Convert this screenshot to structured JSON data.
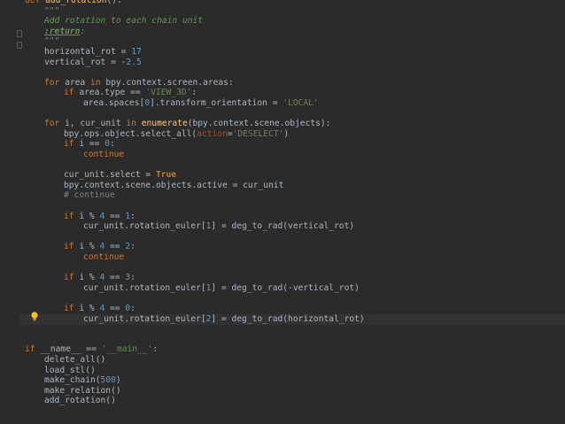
{
  "editor": {
    "lines": [
      {
        "indent": 0,
        "tokens": [
          [
            "kw",
            "def "
          ],
          [
            "fn",
            "add_rotation"
          ],
          [
            "",
            "():"
          ]
        ]
      },
      {
        "indent": 1,
        "tokens": [
          [
            "doc",
            "\"\"\""
          ]
        ]
      },
      {
        "indent": 1,
        "tokens": [
          [
            "doc",
            "Add rotation to each chain unit"
          ]
        ]
      },
      {
        "indent": 1,
        "tokens": [
          [
            "doctag",
            ":return"
          ],
          [
            "doc",
            ":"
          ]
        ]
      },
      {
        "indent": 1,
        "tokens": [
          [
            "doc",
            "\"\"\""
          ]
        ]
      },
      {
        "indent": 1,
        "tokens": [
          [
            "",
            "horizontal_rot = "
          ],
          [
            "num",
            "17"
          ]
        ]
      },
      {
        "indent": 1,
        "tokens": [
          [
            "",
            "vertical_rot = -"
          ],
          [
            "num",
            "2.5"
          ]
        ]
      },
      {
        "indent": 0,
        "tokens": []
      },
      {
        "indent": 1,
        "tokens": [
          [
            "kw",
            "for "
          ],
          [
            "",
            "area "
          ],
          [
            "kw",
            "in "
          ],
          [
            "",
            "bpy.context.screen.areas:"
          ]
        ]
      },
      {
        "indent": 2,
        "tokens": [
          [
            "kw",
            "if "
          ],
          [
            "",
            "area.type == "
          ],
          [
            "str",
            "'VIEW_3D'"
          ],
          [
            "",
            ":"
          ]
        ]
      },
      {
        "indent": 3,
        "tokens": [
          [
            "",
            "area.spaces["
          ],
          [
            "num",
            "0"
          ],
          [
            "",
            "].transform_orientation = "
          ],
          [
            "str",
            "'LOCAL'"
          ]
        ]
      },
      {
        "indent": 0,
        "tokens": []
      },
      {
        "indent": 1,
        "tokens": [
          [
            "kw",
            "for "
          ],
          [
            "",
            "i, cur_unit "
          ],
          [
            "kw",
            "in "
          ],
          [
            "fn",
            "enumerate"
          ],
          [
            "",
            "(bpy.context.scene.objects):"
          ]
        ]
      },
      {
        "indent": 2,
        "tokens": [
          [
            "",
            "bpy.ops.object.select_all("
          ],
          [
            "param",
            "action"
          ],
          [
            "",
            "="
          ],
          [
            "str",
            "'DESELECT'"
          ],
          [
            "",
            ")"
          ]
        ]
      },
      {
        "indent": 2,
        "tokens": [
          [
            "kw",
            "if "
          ],
          [
            "",
            "i == "
          ],
          [
            "num",
            "0"
          ],
          [
            "",
            ":"
          ]
        ]
      },
      {
        "indent": 3,
        "tokens": [
          [
            "kw",
            "continue"
          ]
        ]
      },
      {
        "indent": 0,
        "tokens": []
      },
      {
        "indent": 2,
        "tokens": [
          [
            "",
            "cur_unit.select = "
          ],
          [
            "bool",
            "True"
          ]
        ]
      },
      {
        "indent": 2,
        "tokens": [
          [
            "",
            "bpy.context.scene.objects.active = cur_unit"
          ]
        ]
      },
      {
        "indent": 2,
        "tokens": [
          [
            "cmt",
            "# continue"
          ]
        ]
      },
      {
        "indent": 0,
        "tokens": []
      },
      {
        "indent": 2,
        "tokens": [
          [
            "kw",
            "if "
          ],
          [
            "",
            "i % "
          ],
          [
            "num",
            "4"
          ],
          [
            "",
            " == "
          ],
          [
            "num",
            "1"
          ],
          [
            "",
            ":"
          ]
        ]
      },
      {
        "indent": 3,
        "tokens": [
          [
            "",
            "cur_unit.rotation_euler["
          ],
          [
            "num",
            "1"
          ],
          [
            "",
            "] = deg_to_rad(vertical_rot)"
          ]
        ]
      },
      {
        "indent": 0,
        "tokens": []
      },
      {
        "indent": 2,
        "tokens": [
          [
            "kw",
            "if "
          ],
          [
            "",
            "i % "
          ],
          [
            "num",
            "4"
          ],
          [
            "",
            " == "
          ],
          [
            "num",
            "2"
          ],
          [
            "",
            ":"
          ]
        ]
      },
      {
        "indent": 3,
        "tokens": [
          [
            "kw",
            "continue"
          ]
        ]
      },
      {
        "indent": 0,
        "tokens": []
      },
      {
        "indent": 2,
        "tokens": [
          [
            "kw",
            "if "
          ],
          [
            "",
            "i % "
          ],
          [
            "num",
            "4"
          ],
          [
            "",
            " == "
          ],
          [
            "num",
            "3"
          ],
          [
            "",
            ":"
          ]
        ]
      },
      {
        "indent": 3,
        "tokens": [
          [
            "",
            "cur_unit.rotation_euler["
          ],
          [
            "num",
            "1"
          ],
          [
            "",
            "] = deg_to_rad(-vertical_rot)"
          ]
        ]
      },
      {
        "indent": 0,
        "tokens": []
      },
      {
        "indent": 2,
        "tokens": [
          [
            "kw",
            "if "
          ],
          [
            "",
            "i % "
          ],
          [
            "num",
            "4"
          ],
          [
            "",
            " == "
          ],
          [
            "num",
            "0"
          ],
          [
            "",
            ":"
          ]
        ]
      },
      {
        "indent": 3,
        "tokens": [
          [
            "",
            "cur_unit.rotation_euler["
          ],
          [
            "num",
            "2"
          ],
          [
            "",
            "] = deg_to_rad(horizontal_rot)"
          ]
        ]
      },
      {
        "indent": 0,
        "tokens": []
      },
      {
        "indent": 0,
        "tokens": []
      },
      {
        "indent": 0,
        "tokens": [
          [
            "kw",
            "if "
          ],
          [
            "",
            "__name__ == "
          ],
          [
            "str",
            "'__main__'"
          ],
          [
            "",
            ":"
          ]
        ]
      },
      {
        "indent": 1,
        "tokens": [
          [
            "",
            "delete_all()"
          ]
        ]
      },
      {
        "indent": 1,
        "tokens": [
          [
            "",
            "load_stl()"
          ]
        ]
      },
      {
        "indent": 1,
        "tokens": [
          [
            "",
            "make_chain("
          ],
          [
            "num",
            "500"
          ],
          [
            "",
            ")"
          ]
        ]
      },
      {
        "indent": 1,
        "tokens": [
          [
            "",
            "make_relation()"
          ]
        ]
      },
      {
        "indent": 1,
        "tokens": [
          [
            "",
            "add_rotation()"
          ]
        ]
      }
    ]
  },
  "colors": {
    "background": "#2b2b2b",
    "keyword": "#cc7832",
    "string": "#6a8759",
    "number": "#6897bb",
    "docstring": "#629755",
    "comment": "#808080",
    "default": "#a9b7c6"
  },
  "icons": {
    "intention": "lightbulb-icon",
    "fold": "fold-marker-icon"
  }
}
